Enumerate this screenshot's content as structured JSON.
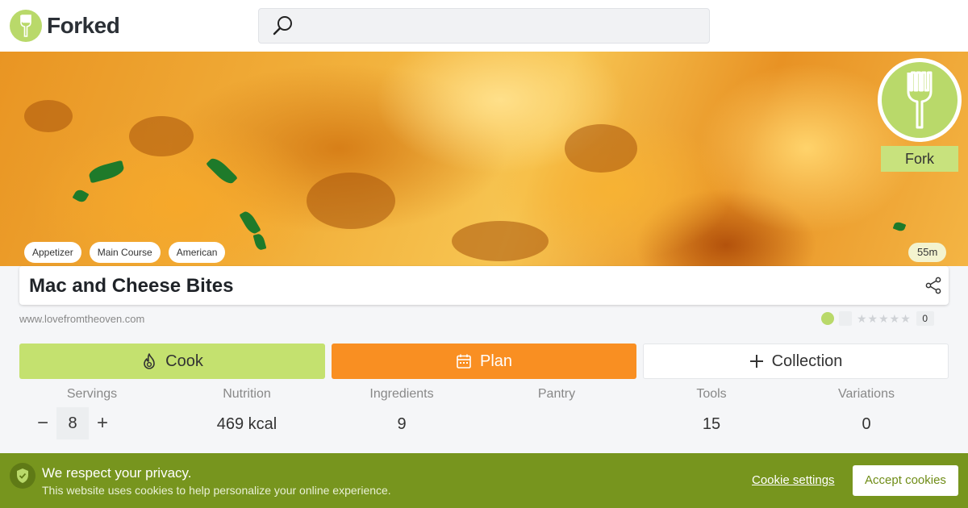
{
  "header": {
    "logo_text": "Forked",
    "search": {
      "placeholder": "",
      "value": ""
    }
  },
  "hero": {
    "tags": [
      "Appetizer",
      "Main Course",
      "American"
    ],
    "time": "55m",
    "fork_label": "Fork"
  },
  "recipe": {
    "title": "Mac and Cheese Bites",
    "source": "www.lovefromtheoven.com",
    "rating": {
      "stars": "★★★★★",
      "count": "0"
    }
  },
  "actions": {
    "cook": "Cook",
    "plan": "Plan",
    "collection": "Collection"
  },
  "stats": {
    "servings": {
      "label": "Servings",
      "value": "8",
      "minus": "−",
      "plus": "+"
    },
    "nutrition": {
      "label": "Nutrition",
      "value": "469 kcal"
    },
    "ingredients": {
      "label": "Ingredients",
      "value": "9"
    },
    "pantry": {
      "label": "Pantry",
      "value": ""
    },
    "tools": {
      "label": "Tools",
      "value": "15"
    },
    "variations": {
      "label": "Variations",
      "value": "0"
    }
  },
  "cookie": {
    "title": "We respect your privacy.",
    "text": "This website uses cookies to help personalize your online experience.",
    "settings": "Cookie settings",
    "accept": "Accept cookies"
  },
  "icons": [
    "fork-icon",
    "search-icon",
    "share-icon",
    "flame-icon",
    "calendar-icon",
    "plus-icon",
    "shield-check-icon"
  ],
  "colors": {
    "brand_green": "#b9d96a",
    "cook": "#c4e16f",
    "plan": "#f98f22",
    "cookie_bar": "#77951e"
  }
}
